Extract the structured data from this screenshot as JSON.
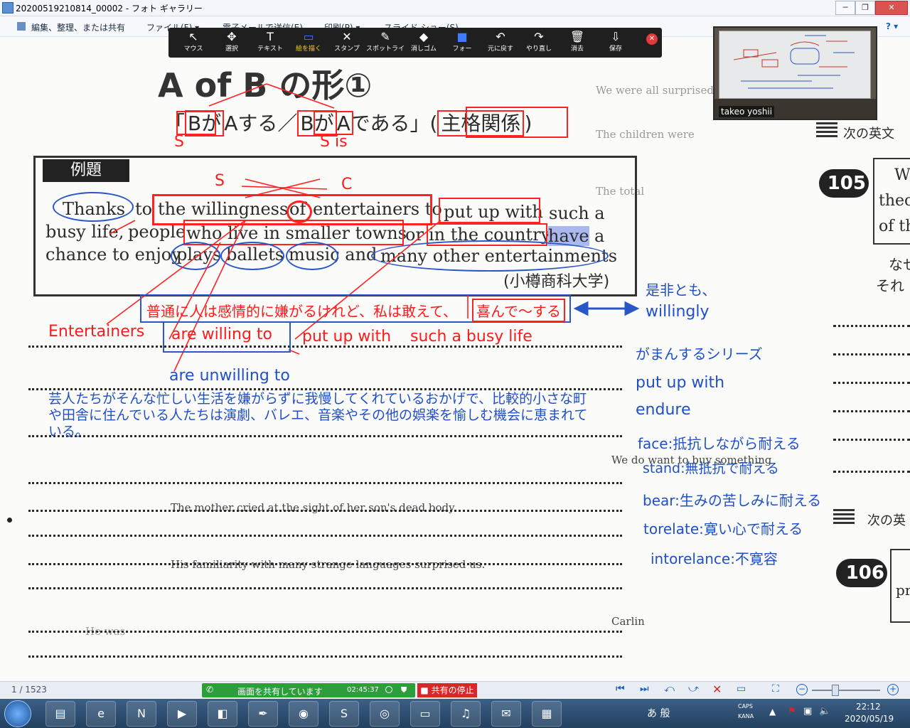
{
  "window": {
    "title": "20200519210814_00002 - フォト ギャラリー",
    "minimize": "─",
    "maximize": "❐",
    "close": "✕"
  },
  "menubar": {
    "organize": "編集、整理、または共有",
    "file": "ファイル(F) ▾",
    "email": "電子メールで送信(E)",
    "print": "印刷(P) ▾",
    "slideshow": "スライド ショー(S)",
    "help": "? ▾"
  },
  "zoom_toolbar": {
    "tools": [
      {
        "icon": "cursor-icon",
        "glyph": "↖",
        "label": "マウス"
      },
      {
        "icon": "move-icon",
        "glyph": "✥",
        "label": "選択"
      },
      {
        "icon": "text-icon",
        "glyph": "T",
        "label": "テキスト"
      },
      {
        "icon": "rectangle-icon",
        "glyph": "▭",
        "label": "絵を描く"
      },
      {
        "icon": "stamp-icon",
        "glyph": "✕",
        "label": "スタンプ"
      },
      {
        "icon": "spotlight-icon",
        "glyph": "✎",
        "label": "スポットライ"
      },
      {
        "icon": "eraser-icon",
        "glyph": "◆",
        "label": "消しゴム"
      },
      {
        "icon": "color-icon",
        "glyph": "■",
        "label": "フォー"
      },
      {
        "icon": "undo-icon",
        "glyph": "↶",
        "label": "元に戻す"
      },
      {
        "icon": "redo-icon",
        "glyph": "↷",
        "label": "やり直し"
      },
      {
        "icon": "trash-icon",
        "glyph": "🗑",
        "label": "消去"
      },
      {
        "icon": "save-icon",
        "glyph": "⇩",
        "label": "保存"
      }
    ],
    "close_glyph": "✕"
  },
  "video": {
    "participant": "takeo yoshii"
  },
  "page": {
    "heading": "A of B の形①",
    "subheading_left": "「",
    "subheading_b1": "Bが",
    "subheading_mid": "Aする／",
    "subheading_b2": "Bが",
    "subheading_end": "Aである」(",
    "subheading_box": "主格関係",
    "subheading_close": ")",
    "example_label": "例題",
    "line1_thanks": "Thanks",
    "line1_to": "to",
    "line1_will": "the willingness",
    "line1_of": "of",
    "line1_ent": "entertainers to",
    "line1_put": "put up with",
    "line1_such": "such a",
    "line2_busy": "busy life,",
    "line2_people": "people",
    "line2_who": "who live in smaller towns",
    "line2_or": "or",
    "line2_country": "in the country",
    "line2_have": "have",
    "line2_a": "a",
    "line3_chance": "chance to enjoy",
    "line3_plays": "plays",
    "line3_ballets": "ballets",
    "line3_music": "music",
    "line3_and": ", and",
    "line3_many": "many other entertainments",
    "source": "(小樽商科大学)",
    "right_heading1": "次の英文",
    "right_num1": "105",
    "right_heading2": "次の英",
    "right_num2": "106",
    "right_word_w": "W",
    "right_word_the": "theo",
    "right_word_of": "of th",
    "right_word_nase": "なせ",
    "right_word_sore": "それ",
    "right_word_pr": "pr",
    "bg_lines": [
      "We were all surprised by",
      "The children were",
      "The total",
      "We do want to buy something",
      "The mother cried at the sight of her son's dead body.",
      "His familiarity with many strange languages surprised us.",
      "Carlin",
      "He was"
    ]
  },
  "annotations": {
    "red": {
      "s_label1": "S",
      "s_is": "S is",
      "s_label2": "S",
      "c_label": "C",
      "translation_line": "普通に人は感情的に嫌がるけれど、私は敢えて、",
      "translation_box": "喜んで〜する",
      "entertainers": "Entertainers",
      "are_willing": "are willing to",
      "put_up_with": "put up with",
      "busy_life": "such a busy life"
    },
    "blue": {
      "zehitomo": "是非とも、",
      "willingly": "willingly",
      "gaman": "がまんするシリーズ",
      "putup": "put up with",
      "endure": "endure",
      "face": "face:抵抗しながら耐える",
      "stand": "stand:無抵抗で耐える",
      "bear": "bear:生みの苦しみに耐える",
      "tolerate": "torelate:寛い心で耐える",
      "intolerance": "intorelance:不寛容",
      "unwilling": "are unwilling to",
      "jp_translation": "芸人たちがそんな忙しい生活を嫌がらずに我慢してくれているおかげで、比較的小さな町や田舎に住んでいる人たちは演劇、バレエ、音楽やその他の娯楽を愉しむ機会に恵まれている。"
    }
  },
  "statusbar": {
    "page_counter": "1 / 1523",
    "share_status": "画面を共有しています",
    "share_time": "02:45:37",
    "stop_share": "■ 共有の停止"
  },
  "taskbar": {
    "apps": [
      "folder-icon",
      "edge-icon",
      "onenote-icon",
      "media-icon",
      "office-icon",
      "feather-icon",
      "zoom-icon",
      "skype-icon",
      "chrome-icon",
      "emu-icon",
      "music-icon",
      "mail-icon",
      "network-icon"
    ],
    "ime": "あ 般",
    "caps": "CAPS",
    "kana": "KANA",
    "time": "22:12",
    "date": "2020/05/19"
  },
  "colors": {
    "annotation_red": "#ff1a1a",
    "annotation_blue": "#1f4fc9",
    "share_green": "#2e9e3a",
    "stop_red": "#d62828"
  }
}
